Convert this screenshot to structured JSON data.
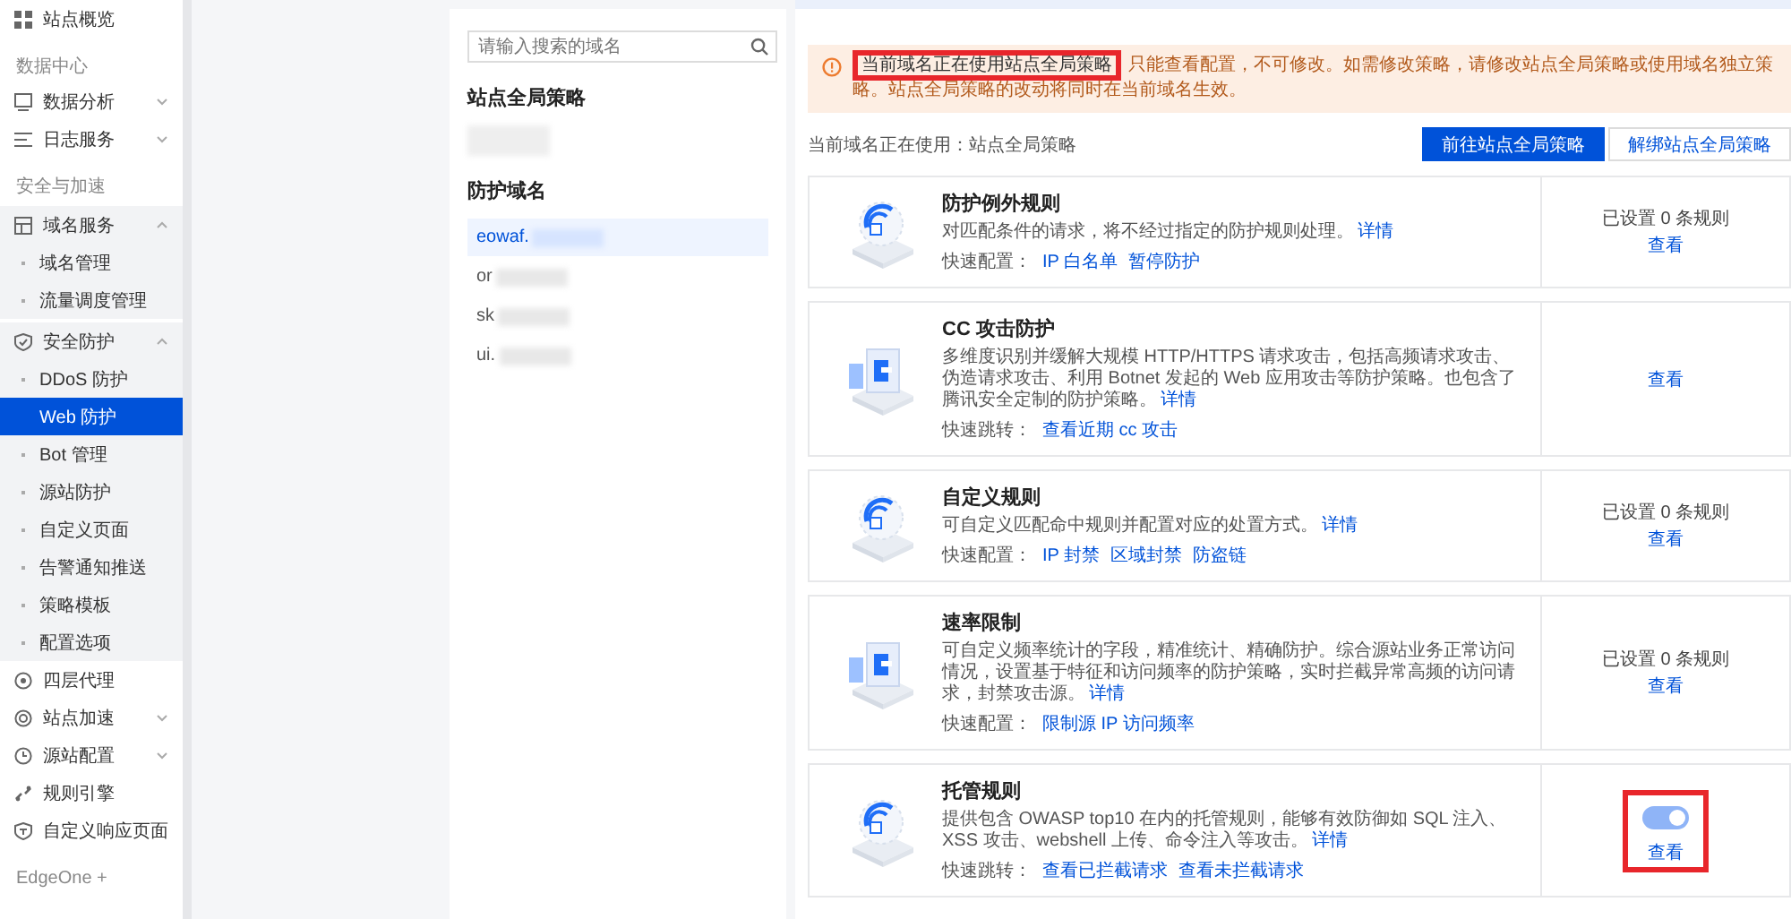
{
  "sidebar": {
    "items": [
      {
        "kind": "item",
        "label": "站点概览"
      },
      {
        "kind": "section",
        "label": "数据中心"
      },
      {
        "kind": "item",
        "label": "数据分析",
        "expanded": false
      },
      {
        "kind": "item",
        "label": "日志服务",
        "expanded": false
      },
      {
        "kind": "section",
        "label": "安全与加速"
      },
      {
        "kind": "item",
        "label": "域名服务",
        "expanded": true,
        "children": [
          {
            "label": "域名管理",
            "selected": false
          },
          {
            "label": "流量调度管理",
            "selected": false
          }
        ]
      },
      {
        "kind": "item",
        "label": "安全防护",
        "expanded": true,
        "children": [
          {
            "label": "DDoS 防护",
            "selected": false
          },
          {
            "label": "Web 防护",
            "selected": true
          },
          {
            "label": "Bot 管理",
            "selected": false
          },
          {
            "label": "源站防护",
            "selected": false
          },
          {
            "label": "自定义页面",
            "selected": false
          },
          {
            "label": "告警通知推送",
            "selected": false
          },
          {
            "label": "策略模板",
            "selected": false
          },
          {
            "label": "配置选项",
            "selected": false
          }
        ]
      },
      {
        "kind": "item",
        "label": "四层代理"
      },
      {
        "kind": "item",
        "label": "站点加速",
        "expanded": false
      },
      {
        "kind": "item",
        "label": "源站配置",
        "expanded": false
      },
      {
        "kind": "item",
        "label": "规则引擎"
      },
      {
        "kind": "item",
        "label": "自定义响应页面"
      },
      {
        "kind": "section",
        "label": "EdgeOne +"
      }
    ]
  },
  "domain_panel": {
    "search": {
      "placeholder": "请输入搜索的域名"
    },
    "global_title": "站点全局策略",
    "domains_title": "防护域名",
    "domains": [
      {
        "name": "eowaf.",
        "selected": true
      },
      {
        "name": "or",
        "selected": false
      },
      {
        "name": "sk",
        "selected": false
      },
      {
        "name": "ui.",
        "selected": false
      }
    ]
  },
  "alert": {
    "lead": "当前域名正在使用站点全局策略",
    "highlighted": true,
    "text": "只能查看配置，不可修改。如需修改策略，请修改站点全局策略或使用域名独立策略。站点全局策略的改动将同时在当前域名生效。"
  },
  "policy_line": "当前域名正在使用：站点全局策略",
  "buttons": [
    {
      "label": "前往站点全局策略",
      "kind": "primary"
    },
    {
      "label": "解绑站点全局策略",
      "kind": "secondary"
    }
  ],
  "cards": [
    {
      "title": "防护例外规则",
      "description": "对匹配条件的请求，将不经过指定的防护规则处理。",
      "detail_link": "详情",
      "quick_label": "快速配置：",
      "quick_links": [
        "IP 白名单",
        "暂停防护"
      ],
      "status": "已设置 0 条规则",
      "view_link": "查看"
    },
    {
      "title": "CC 攻击防护",
      "description": "多维度识别并缓解大规模 HTTP/HTTPS 请求攻击，包括高频请求攻击、伪造请求攻击、利用 Botnet 发起的 Web 应用攻击等防护策略。也包含了腾讯安全定制的防护策略。",
      "detail_link": "详情",
      "quick_label": "快速跳转：",
      "quick_links": [
        "查看近期 cc 攻击"
      ],
      "view_link": "查看"
    },
    {
      "title": "自定义规则",
      "description": "可自定义匹配命中规则并配置对应的处置方式。",
      "detail_link": "详情",
      "quick_label": "快速配置：",
      "quick_links": [
        "IP 封禁",
        "区域封禁",
        "防盗链"
      ],
      "status": "已设置 0 条规则",
      "view_link": "查看"
    },
    {
      "title": "速率限制",
      "description": "可自定义频率统计的字段，精准统计、精确防护。综合源站业务正常访问情况，设置基于特征和访问频率的防护策略，实时拦截异常高频的访问请求，封禁攻击源。",
      "detail_link": "详情",
      "quick_label": "快速配置：",
      "quick_links": [
        "限制源 IP 访问频率"
      ],
      "status": "已设置 0 条规则",
      "view_link": "查看"
    },
    {
      "title": "托管规则",
      "description": "提供包含 OWASP top10 在内的托管规则，能够有效防御如 SQL 注入、XSS 攻击、webshell 上传、命令注入等攻击。",
      "detail_link": "详情",
      "quick_label": "快速跳转：",
      "quick_links": [
        "查看已拦截请求",
        "查看未拦截请求"
      ],
      "toggle": {
        "on": true,
        "disabled": true,
        "highlighted": true
      },
      "view_link": "查看"
    }
  ]
}
